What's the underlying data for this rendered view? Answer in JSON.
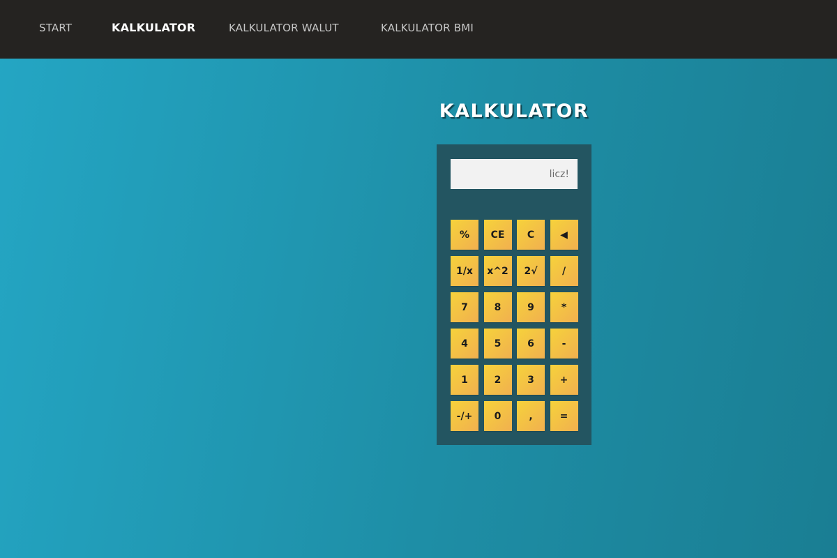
{
  "nav": {
    "items": [
      {
        "label": "START",
        "active": false
      },
      {
        "label": "KALKULATOR",
        "active": true
      },
      {
        "label": "KALKULATOR WALUT",
        "active": false
      },
      {
        "label": "KALKULATOR BMI",
        "active": false
      }
    ]
  },
  "main": {
    "title": "KALKULATOR"
  },
  "calculator": {
    "display_value": "",
    "display_placeholder": "licz!",
    "keys": [
      [
        "%",
        "CE",
        "C",
        "◀"
      ],
      [
        "1/x",
        "x^2",
        "2√",
        "/"
      ],
      [
        "7",
        "8",
        "9",
        "*"
      ],
      [
        "4",
        "5",
        "6",
        "-"
      ],
      [
        "1",
        "2",
        "3",
        "+"
      ],
      [
        "-/+",
        "0",
        ",",
        "="
      ]
    ]
  },
  "colors": {
    "navbar_bg": "#252321",
    "background_start": "#24a6c4",
    "background_end": "#1a7e93",
    "calculator_body": "#235561",
    "key_gradient_start": "#f6d23b",
    "key_gradient_end": "#f1b04f",
    "display_bg": "#f2f2f2"
  }
}
